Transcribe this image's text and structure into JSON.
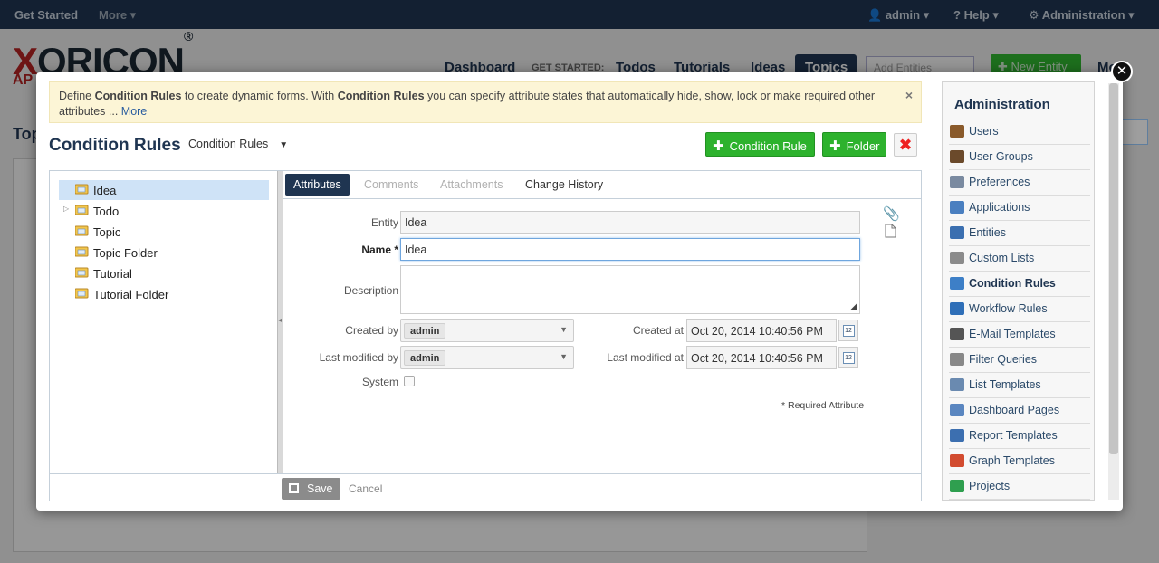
{
  "topbar": {
    "get_started": "Get Started",
    "more": "More ▾",
    "user": "admin ▾",
    "help": "Help ▾",
    "administration": "Administration ▾"
  },
  "background": {
    "logo_x": "X",
    "logo_rest": "ORICON",
    "logo_reg": "®",
    "logo_sub": "AP",
    "nav": {
      "dashboard": "Dashboard",
      "get_started": "GET STARTED:",
      "todos": "Todos",
      "tutorials": "Tutorials",
      "ideas": "Ideas",
      "topics": "Topics"
    },
    "search_placeholder": "Add Entities",
    "new_entity": "✚ New Entity",
    "more": "Mo",
    "page_title_fragment": "Top"
  },
  "modal": {
    "close": "✕",
    "notice": {
      "p1": "Define ",
      "b1": "Condition Rules",
      "p2": " to create dynamic forms. With ",
      "b2": "Condition Rules",
      "p3": " you can specify attribute states that automatically hide, show, lock or make required other attributes ... ",
      "more": "More",
      "dismiss": "×"
    },
    "title": "Condition Rules",
    "selector": "Condition Rules",
    "selector_caret": "▼",
    "buttons": {
      "plus": "✚",
      "condition_rule": "Condition Rule",
      "folder": "Folder",
      "delete": "✖"
    },
    "tree": [
      {
        "label": "Idea",
        "selected": true,
        "expandable": false
      },
      {
        "label": "Todo",
        "selected": false,
        "expandable": true
      },
      {
        "label": "Topic",
        "selected": false,
        "expandable": false
      },
      {
        "label": "Topic Folder",
        "selected": false,
        "expandable": false
      },
      {
        "label": "Tutorial",
        "selected": false,
        "expandable": false
      },
      {
        "label": "Tutorial Folder",
        "selected": false,
        "expandable": false
      }
    ],
    "tabs": [
      "Attributes",
      "Comments",
      "Attachments",
      "Change History"
    ],
    "form": {
      "entity_label": "Entity",
      "entity_value": "Idea",
      "name_label": "Name *",
      "name_value": "Idea",
      "description_label": "Description",
      "created_by_label": "Created by",
      "created_by_value": "admin",
      "last_modified_by_label": "Last modified by",
      "last_modified_by_value": "admin",
      "created_at_label": "Created at",
      "created_at_value": "Oct 20, 2014 10:40:56 PM",
      "last_modified_at_label": "Last modified at",
      "last_modified_at_value": "Oct 20, 2014 10:40:56 PM",
      "calendar_glyph": "12",
      "system_label": "System",
      "system_checked": false,
      "required_note": "* Required Attribute"
    },
    "footer": {
      "save": "Save",
      "cancel": "Cancel"
    },
    "admin": {
      "title": "Administration",
      "items": [
        {
          "label": "Users",
          "color": "#8a5a2b"
        },
        {
          "label": "User Groups",
          "color": "#6b4a2b"
        },
        {
          "label": "Preferences",
          "color": "#7a8aa0"
        },
        {
          "label": "Applications",
          "color": "#4a7fc0"
        },
        {
          "label": "Entities",
          "color": "#3b6fb0"
        },
        {
          "label": "Custom Lists",
          "color": "#8b8b8b"
        },
        {
          "label": "Condition Rules",
          "color": "#3d7fc7"
        },
        {
          "label": "Workflow Rules",
          "color": "#2f6fb8"
        },
        {
          "label": "E-Mail Templates",
          "color": "#555555"
        },
        {
          "label": "Filter Queries",
          "color": "#888888"
        },
        {
          "label": "List Templates",
          "color": "#6a8ab0"
        },
        {
          "label": "Dashboard Pages",
          "color": "#5a86c0"
        },
        {
          "label": "Report Templates",
          "color": "#3c6fb0"
        },
        {
          "label": "Graph Templates",
          "color": "#d24b2f"
        },
        {
          "label": "Projects",
          "color": "#2f9f4f"
        }
      ],
      "active": "Condition Rules"
    }
  }
}
